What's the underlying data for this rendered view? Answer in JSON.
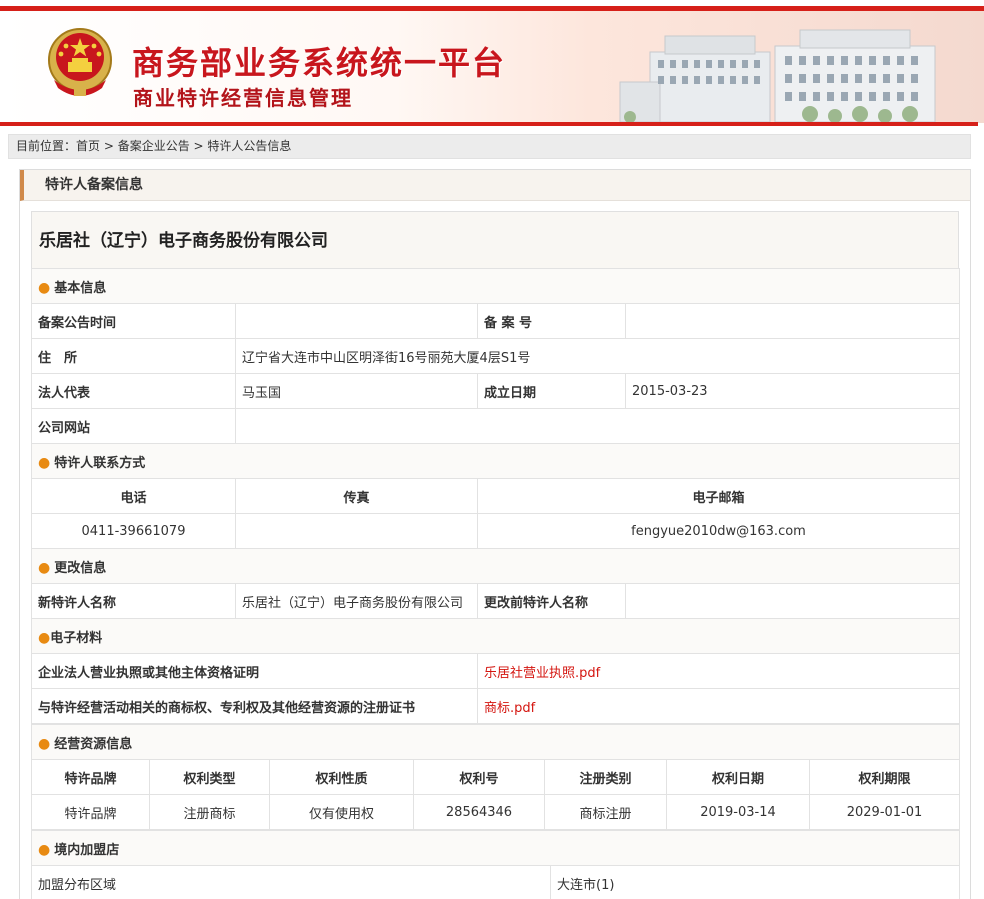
{
  "header": {
    "title_main": "商务部业务系统统一平台",
    "title_sub": "商业特许经营信息管理"
  },
  "breadcrumb": {
    "prefix": "目前位置：",
    "home": "首页",
    "sep1": " > ",
    "level2": "备案企业公告",
    "sep2": " > ",
    "level3": "特许人公告信息"
  },
  "panel_title": "特许人备案信息",
  "company_name": "乐居社（辽宁）电子商务股份有限公司",
  "basic": {
    "section": "基本信息",
    "announce_time_label": "备案公告时间",
    "announce_time_value": "",
    "record_no_label": "备 案 号",
    "record_no_value": "",
    "address_label": "住　所",
    "address_value": "辽宁省大连市中山区明泽街16号丽苑大厦4层S1号",
    "legal_rep_label": "法人代表",
    "legal_rep_value": "马玉国",
    "founded_label": "成立日期",
    "founded_value": "2015-03-23",
    "website_label": "公司网站",
    "website_value": ""
  },
  "contact": {
    "section": "特许人联系方式",
    "phone_label": "电话",
    "fax_label": "传真",
    "email_label": "电子邮箱",
    "phone_value": "0411-39661079",
    "fax_value": "",
    "email_value": "fengyue2010dw@163.com"
  },
  "change": {
    "section": "更改信息",
    "new_name_label": "新特许人名称",
    "new_name_value": "乐居社（辽宁）电子商务股份有限公司",
    "old_name_label": "更改前特许人名称",
    "old_name_value": ""
  },
  "materials": {
    "section": "电子材料",
    "license_label": "企业法人营业执照或其他主体资格证明",
    "license_file": "乐居社营业执照.pdf",
    "trademark_label": "与特许经营活动相关的商标权、专利权及其他经营资源的注册证书",
    "trademark_file": "商标.pdf"
  },
  "resources": {
    "section": "经营资源信息",
    "headers": [
      "特许品牌",
      "权利类型",
      "权利性质",
      "权利号",
      "注册类别",
      "权利日期",
      "权利期限"
    ],
    "rows": [
      [
        "特许品牌",
        "注册商标",
        "仅有使用权",
        "28564346",
        "商标注册",
        "2019-03-14",
        "2029-01-01"
      ]
    ]
  },
  "domestic": {
    "section": "境内加盟店",
    "region_label": "加盟分布区域",
    "region_value": "大连市(1)"
  },
  "colors": {
    "brand_red": "#d62019",
    "section_dot": "#e88a12",
    "pdf_link": "#d4150f"
  }
}
